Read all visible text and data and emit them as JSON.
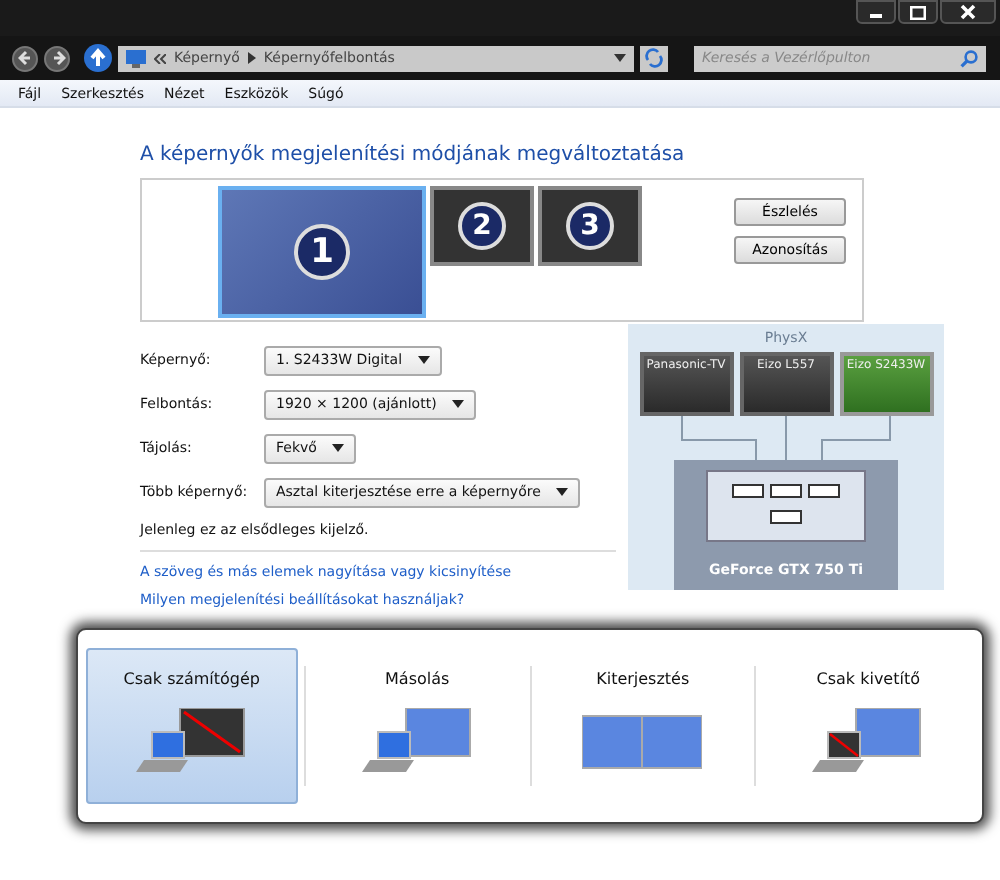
{
  "address_bar": {
    "breadcrumbs": [
      "Képernyő",
      "Képernyőfelbontás"
    ]
  },
  "search": {
    "placeholder": "Keresés a Vezérlőpulton"
  },
  "menu": [
    "Fájl",
    "Szerkesztés",
    "Nézet",
    "Eszközök",
    "Súgó"
  ],
  "heading": "A képernyők megjelenítési módjának megváltoztatása",
  "monitors": [
    {
      "number": "1",
      "selected": true
    },
    {
      "number": "2",
      "selected": false
    },
    {
      "number": "3",
      "selected": false
    }
  ],
  "monitor_buttons": [
    "Észlelés",
    "Azonosítás"
  ],
  "settings": [
    {
      "label": "Képernyő:",
      "value": "1. S2433W Digital"
    },
    {
      "label": "Felbontás:",
      "value": "1920 × 1200 (ajánlott)"
    },
    {
      "label": "Tájolás:",
      "value": "Fekvő"
    },
    {
      "label": "Több képernyő:",
      "value": "Asztal kiterjesztése erre a képernyőre"
    }
  ],
  "status": "Jelenleg ez az elsődleges kijelző.",
  "links": [
    "A szöveg és más elemek nagyítása vagy kicsinyítése",
    "Milyen megjelenítési beállításokat használjak?"
  ],
  "physx": {
    "title": "PhysX",
    "displays": [
      {
        "name": "Panasonic-TV",
        "selected": false
      },
      {
        "name": "Eizo L557",
        "selected": false
      },
      {
        "name": "Eizo S2433W",
        "selected": true
      }
    ],
    "gpu": "GeForce GTX 750 Ti"
  },
  "projection": [
    {
      "label": "Csak számítógép",
      "kind": "pc_only",
      "selected": true
    },
    {
      "label": "Másolás",
      "kind": "duplicate",
      "selected": false
    },
    {
      "label": "Kiterjesztés",
      "kind": "extend",
      "selected": false
    },
    {
      "label": "Csak kivetítő",
      "kind": "projector_only",
      "selected": false
    }
  ]
}
